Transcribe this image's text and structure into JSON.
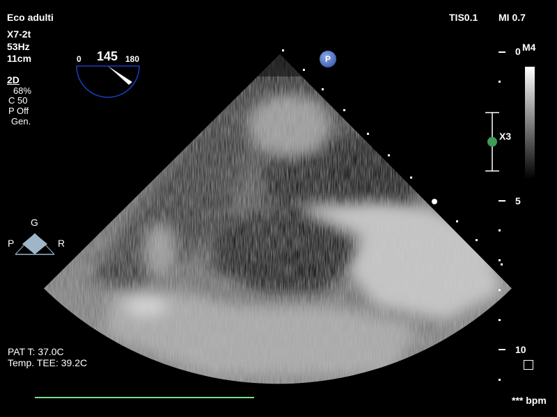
{
  "header": {
    "preset": "Eco adulti",
    "probe": "X7-2t",
    "frame_rate": "53Hz",
    "depth": "11cm",
    "tis": "TIS0.1",
    "mi": "MI 0.7"
  },
  "mode": {
    "label": "2D",
    "gain": "68%",
    "compression": "C 50",
    "persistence": "P Off",
    "resolution": "Gen."
  },
  "angle": {
    "min": "0",
    "value": "145",
    "max": "180",
    "degrees": 145
  },
  "orientation": {
    "top": "G",
    "left": "P",
    "right": "R"
  },
  "scale": {
    "map": "M4",
    "zoom": "X3",
    "depth_0": "0",
    "depth_5": "5",
    "depth_10": "10"
  },
  "patient": {
    "pat_temp": "PAT T: 37.0C",
    "tee_temp": "Temp. TEE: 39.2C"
  },
  "heart_rate": "*** bpm",
  "p_badge": "P",
  "colors": {
    "green_marker": "#3e9a55",
    "green_line": "#7fe07f",
    "angle_arc": "#1a3fbf",
    "orientation_fill": "#9fb6c8"
  }
}
